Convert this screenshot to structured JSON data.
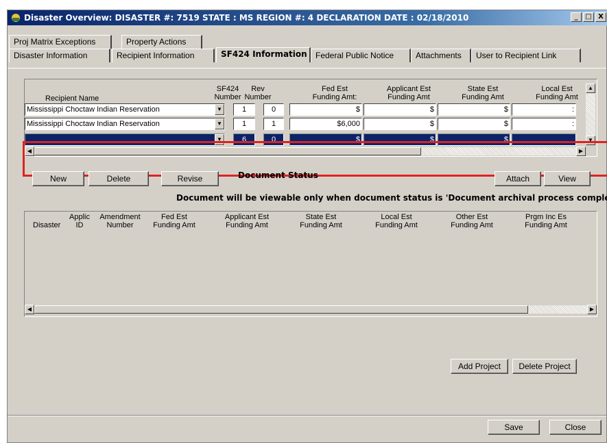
{
  "window": {
    "title": "Disaster Overview:  DISASTER #: 7519  STATE : MS  REGION #: 4  DECLARATION DATE : 02/18/2010",
    "controls": [
      "_",
      "□",
      "X"
    ]
  },
  "tabs_row1": [
    {
      "label": "Proj Matrix Exceptions"
    },
    {
      "label": "Property Actions"
    }
  ],
  "tabs_row2": [
    {
      "label": "Disaster Information"
    },
    {
      "label": "Recipient  Information"
    },
    {
      "label": "SF424  Information",
      "active": true
    },
    {
      "label": "Federal Public Notice"
    },
    {
      "label": "Attachments"
    },
    {
      "label": "User to Recipient Link"
    }
  ],
  "grid": {
    "headers": {
      "recipient_name": "Recipient Name",
      "sf424_number": [
        "SF424",
        "Number"
      ],
      "rev_number": [
        "Rev",
        "Number"
      ],
      "fed_est": [
        "Fed Est",
        "Funding Amt:"
      ],
      "applicant_est": [
        "Applicant Est",
        "Funding Amt"
      ],
      "state_est": [
        "State Est",
        "Funding Amt"
      ],
      "local_est": [
        "Local Est",
        "Funding Amt"
      ]
    },
    "rows": [
      {
        "recipient": "Mississippi Choctaw Indian Reservation",
        "sf424": "1",
        "rev": "0",
        "fed": "$",
        "applicant": "$",
        "state": "$",
        "local": ":"
      },
      {
        "recipient": "Mississippi Choctaw Indian Reservation",
        "sf424": "1",
        "rev": "1",
        "fed": "$6,000",
        "applicant": "$",
        "state": "$",
        "local": ":"
      },
      {
        "recipient": "",
        "sf424": "6",
        "rev": "0",
        "fed": "$",
        "applicant": "$",
        "state": "$",
        "local": ""
      }
    ]
  },
  "buttons": {
    "new": "New",
    "delete": "Delete",
    "revise": "Revise",
    "attach": "Attach",
    "view": "View",
    "add_project": "Add Project",
    "delete_project": "Delete Project",
    "save": "Save",
    "close": "Close"
  },
  "document_status_label": "Document Status",
  "document_note": "Document will be viewable only when document status is 'Document archival process complete'",
  "doc_grid_headers": {
    "disaster": "Disaster",
    "applic_id": [
      "Applic",
      "ID"
    ],
    "amendment_number": [
      "Amendment",
      "Number"
    ],
    "fed_est": [
      "Fed Est",
      "Funding Amt"
    ],
    "applicant_est": [
      "Applicant Est",
      "Funding Amt"
    ],
    "state_est": [
      "State Est",
      "Funding Amt"
    ],
    "local_est": [
      "Local Est",
      "Funding Amt"
    ],
    "other_est": [
      "Other Est",
      "Funding Amt"
    ],
    "prgm_inc_est": [
      "Prgm Inc Es",
      "Funding Amt"
    ]
  },
  "highlight_color": "#e02020",
  "selection_color": "#0a246a"
}
